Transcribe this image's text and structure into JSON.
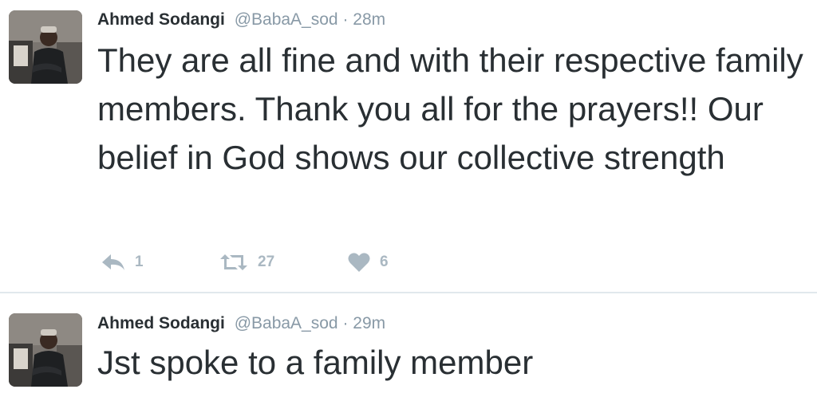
{
  "tweets": [
    {
      "display_name": "Ahmed Sodangi",
      "handle": "@BabaA_sod",
      "separator": "·",
      "time": "28m",
      "text": "They are all fine and with their respective family members. Thank you all for the prayers!! Our belief in God shows our collective strength",
      "actions": {
        "reply": {
          "icon": "reply-icon",
          "count": "1"
        },
        "retweet": {
          "icon": "retweet-icon",
          "count": "27"
        },
        "like": {
          "icon": "heart-icon",
          "count": "6"
        }
      }
    },
    {
      "display_name": "Ahmed Sodangi",
      "handle": "@BabaA_sod",
      "separator": "·",
      "time": "29m",
      "text": "Jst spoke to a family member"
    }
  ],
  "colors": {
    "text": "#292f33",
    "muted": "#8899a6",
    "action": "#aab8c2",
    "divider": "#e1e8ed"
  }
}
